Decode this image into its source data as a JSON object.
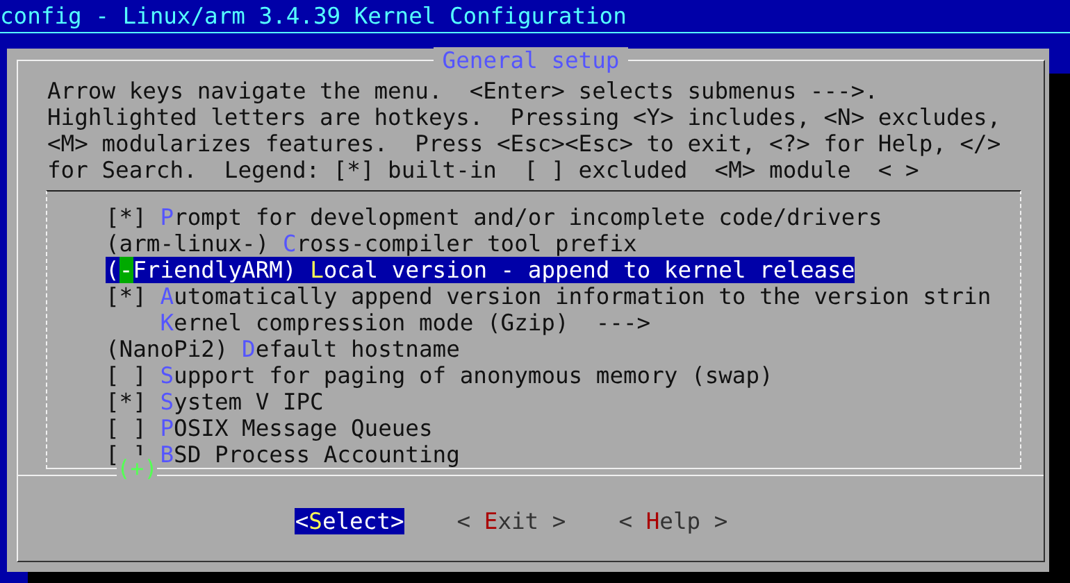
{
  "window": {
    "title": "config - Linux/arm 3.4.39 Kernel Configuration"
  },
  "dialog": {
    "title": "General setup",
    "help_lines": [
      "Arrow keys navigate the menu.  <Enter> selects submenus --->.",
      "Highlighted letters are hotkeys.  Pressing <Y> includes, <N> excludes,",
      "<M> modularizes features.  Press <Esc><Esc> to exit, <?> for Help, </>",
      "for Search.  Legend: [*] built-in  [ ] excluded  <M> module  < >"
    ],
    "items": [
      {
        "prefix": "[*] ",
        "hotkey": "P",
        "label": "rompt for development and/or incomplete code/drivers",
        "selected": false
      },
      {
        "prefix": "(arm-linux-) ",
        "hotkey": "C",
        "label": "ross-compiler tool prefix",
        "selected": false
      },
      {
        "prefix": "(",
        "cursor": "-",
        "prefix_tail": "FriendlyARM) ",
        "hotkey": "L",
        "label": "ocal version - append to kernel release",
        "selected": true
      },
      {
        "prefix": "[*] ",
        "hotkey": "A",
        "label": "utomatically append version information to the version strin",
        "selected": false
      },
      {
        "indented": true,
        "hotkey": "K",
        "label": "ernel compression mode (Gzip)  --->",
        "selected": false
      },
      {
        "prefix": "(NanoPi2) ",
        "hotkey": "D",
        "label": "efault hostname",
        "selected": false
      },
      {
        "prefix": "[ ] ",
        "hotkey": "S",
        "label": "upport for paging of anonymous memory (swap)",
        "selected": false
      },
      {
        "prefix": "[*] ",
        "hotkey": "S",
        "label": "ystem V IPC",
        "selected": false
      },
      {
        "prefix": "[ ] ",
        "hotkey": "P",
        "label": "OSIX Message Queues",
        "selected": false
      },
      {
        "prefix": "[ ] ",
        "hotkey": "B",
        "label": "SD Process Accounting",
        "selected": false
      }
    ],
    "more_indicator": "(+)",
    "buttons": [
      {
        "open": "<",
        "hotkey": "S",
        "label": "elect",
        "close": ">",
        "selected": true
      },
      {
        "open": "< ",
        "hotkey": "E",
        "label": "xit",
        "close": " >",
        "selected": false
      },
      {
        "open": "< ",
        "hotkey": "H",
        "label": "elp",
        "close": " >",
        "selected": false
      }
    ]
  }
}
